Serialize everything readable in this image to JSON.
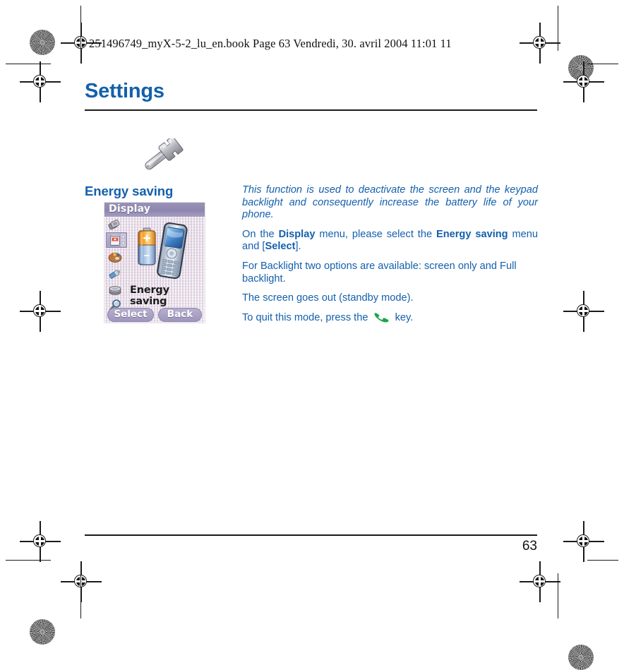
{
  "document": {
    "file_header": "251496749_myX-5-2_lu_en.book  Page 63  Vendredi, 30. avril 2004  11:01 11",
    "chapter_title": "Settings",
    "section_heading": "Energy saving",
    "page_number": "63",
    "accent_color": "#1360ac",
    "section_icon": "wrench-icon"
  },
  "body": {
    "intro": "This function is used to deactivate the screen and the keypad backlight and consequently increase the battery life of your phone.",
    "para2_part1": "On the ",
    "para2_bold1": "Display",
    "para2_part2": " menu, please select the ",
    "para2_bold2": "Energy saving",
    "para2_part3": " menu and [",
    "para2_bold3": "Select",
    "para2_part4": "].",
    "para3": "For Backlight two options are available: screen only and Full backlight.",
    "para4": "The screen goes out (standby mode).",
    "para5_part1": "To quit this mode, press the ",
    "para5_icon": "hangup-key-icon",
    "para5_part2": " key."
  },
  "phone_screenshot": {
    "title_bar": "Display",
    "title_bar_color": "#8e86ae",
    "menu_label": "Energy saving",
    "softkey_left": "Select",
    "softkey_right": "Back",
    "illustration": "battery-and-phone-illustration",
    "icons": [
      {
        "name": "sim-cards-icon"
      },
      {
        "name": "battery-selected-icon"
      },
      {
        "name": "palette-icon"
      },
      {
        "name": "brush-icon"
      },
      {
        "name": "coin-stack-icon"
      },
      {
        "name": "magnifier-icon"
      }
    ],
    "scrollbar": "vertical-scroll-arrows"
  }
}
